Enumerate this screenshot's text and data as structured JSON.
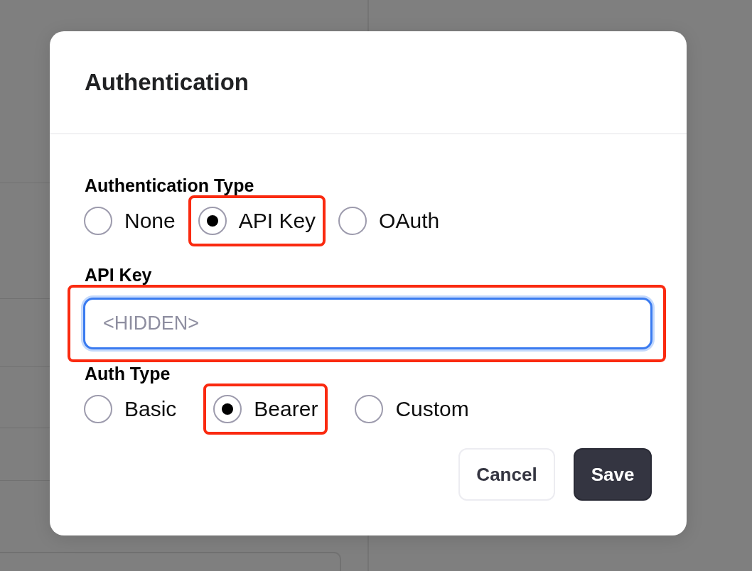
{
  "dialog": {
    "title": "Authentication",
    "auth_type": {
      "label": "Authentication Type",
      "options": [
        {
          "label": "None",
          "selected": false,
          "highlighted": false
        },
        {
          "label": "API Key",
          "selected": true,
          "highlighted": true
        },
        {
          "label": "OAuth",
          "selected": false,
          "highlighted": false
        }
      ]
    },
    "api_key": {
      "label": "API Key",
      "placeholder": "<HIDDEN>",
      "focused": true,
      "highlighted": true
    },
    "auth_scheme": {
      "label": "Auth Type",
      "options": [
        {
          "label": "Basic",
          "selected": false,
          "highlighted": false
        },
        {
          "label": "Bearer",
          "selected": true,
          "highlighted": true
        },
        {
          "label": "Custom",
          "selected": false,
          "highlighted": false
        }
      ]
    },
    "buttons": [
      {
        "label": "Cancel",
        "kind": "secondary"
      },
      {
        "label": "Save",
        "kind": "primary"
      }
    ]
  }
}
